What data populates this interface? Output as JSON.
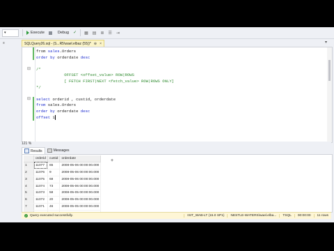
{
  "toolbar": {
    "execute": "Execute",
    "debug": "Debug",
    "db_placeholder": ""
  },
  "gutter": {
    "tab_label": "≡"
  },
  "document_tab": {
    "label": "SQLQuery26.sql - (S...R5\\wael.elbaz (55))*",
    "pin": "⊕",
    "close": "×"
  },
  "editor": {
    "lines": [
      {
        "parts": [
          {
            "c": "txt",
            "t": "from "
          },
          {
            "c": "kw",
            "t": "sales"
          },
          {
            "c": "txt",
            "t": ".Orders"
          }
        ]
      },
      {
        "parts": [
          {
            "c": "kw",
            "t": "order by "
          },
          {
            "c": "txt",
            "t": "orderdate "
          },
          {
            "c": "kw",
            "t": "desc"
          }
        ]
      },
      {
        "parts": [
          {
            "c": "txt",
            "t": ""
          }
        ]
      },
      {
        "parts": [
          {
            "c": "cmt",
            "t": "/*"
          }
        ]
      },
      {
        "parts": [
          {
            "c": "cmt",
            "t": "            OFFSET <offset_value> ROW|ROWS"
          }
        ]
      },
      {
        "parts": [
          {
            "c": "cmt",
            "t": "            [ FETCH FIRST|NEXT <fetch_value> ROW|ROWS ONLY]"
          }
        ]
      },
      {
        "parts": [
          {
            "c": "cmt",
            "t": "*/"
          }
        ]
      },
      {
        "parts": [
          {
            "c": "txt",
            "t": ""
          }
        ]
      },
      {
        "parts": [
          {
            "c": "kw",
            "t": "select "
          },
          {
            "c": "txt",
            "t": "orderid , custid, orderdate"
          }
        ]
      },
      {
        "parts": [
          {
            "c": "kw",
            "t": "from "
          },
          {
            "c": "txt",
            "t": "sales.Orders"
          }
        ]
      },
      {
        "parts": [
          {
            "c": "kw",
            "t": "order by "
          },
          {
            "c": "txt",
            "t": "orderdate "
          },
          {
            "c": "kw",
            "t": "desc"
          }
        ]
      },
      {
        "parts": [
          {
            "c": "kw",
            "t": "offset "
          },
          {
            "c": "txt",
            "t": "1"
          }
        ],
        "caret": true
      }
    ],
    "zoom": "121 %"
  },
  "results_tabs": {
    "results": "Results",
    "messages": "Messages"
  },
  "results": {
    "columns": [
      "orderid",
      "custid",
      "orderdate"
    ],
    "rows": [
      [
        "1",
        "11077",
        "65",
        "2008-05-06 00:00:00.000"
      ],
      [
        "2",
        "11076",
        "9",
        "2008-05-06 00:00:00.000"
      ],
      [
        "3",
        "11075",
        "68",
        "2008-05-06 00:00:00.000"
      ],
      [
        "4",
        "11074",
        "73",
        "2008-05-06 00:00:00.000"
      ],
      [
        "5",
        "11073",
        "58",
        "2008-05-05 00:00:00.000"
      ],
      [
        "6",
        "11072",
        "20",
        "2008-05-05 00:00:00.000"
      ],
      [
        "7",
        "11071",
        "46",
        "2008-05-05 00:00:00.000"
      ],
      [
        "8",
        "11070",
        "44",
        "2008-05-05 00:00:00.000"
      ],
      [
        "9",
        "11069",
        "80",
        "2008-05-04 00:00:00.000"
      ],
      [
        "10",
        "11068",
        "62",
        "2008-05-04 00:00:00.000"
      ],
      [
        "11",
        "11067",
        "17",
        "2008-05-04 00:00:00.000"
      ]
    ]
  },
  "status": {
    "message": "Query executed successfully.",
    "server": "ISIT_WAB-LT (15.0 SP1)",
    "user": "NESTLE-WATERS\\wael.elba...",
    "database": "TSQL",
    "elapsed": "00:00:00",
    "rows": "11 rows"
  },
  "colors": {
    "keyword": "#1f2ecf",
    "comment": "#2d8a2d",
    "status_bg": "#fef6d6"
  }
}
